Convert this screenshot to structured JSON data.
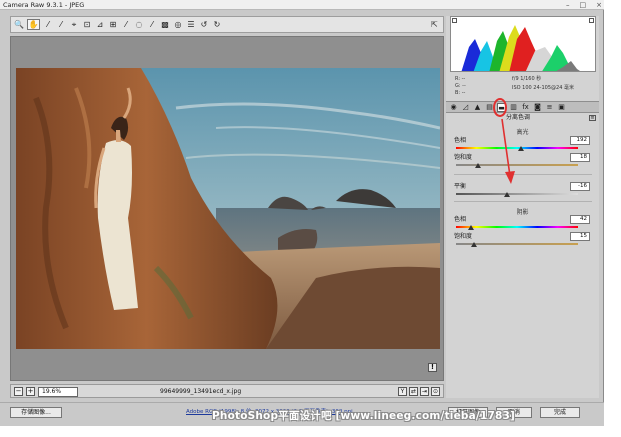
{
  "window": {
    "title": "Camera Raw 9.3.1 - JPEG",
    "controls": [
      "–",
      "□",
      "×"
    ]
  },
  "toolbar": {
    "tools": [
      {
        "icon": "zoom-icon",
        "glyph": "🔍"
      },
      {
        "icon": "hand-icon",
        "glyph": "✋"
      },
      {
        "icon": "white-balance-icon",
        "glyph": "⁄"
      },
      {
        "icon": "color-sampler-icon",
        "glyph": "⁄"
      },
      {
        "icon": "target-adjust-icon",
        "glyph": "⌖"
      },
      {
        "icon": "crop-icon",
        "glyph": "⊡"
      },
      {
        "icon": "straighten-icon",
        "glyph": "⊿"
      },
      {
        "icon": "transform-icon",
        "glyph": "⊞"
      },
      {
        "icon": "spot-removal-icon",
        "glyph": "⁄"
      },
      {
        "icon": "red-eye-icon",
        "glyph": "◌"
      },
      {
        "icon": "brush-icon",
        "glyph": "⁄"
      },
      {
        "icon": "graduated-filter-icon",
        "glyph": "▩"
      },
      {
        "icon": "radial-filter-icon",
        "glyph": "◎"
      },
      {
        "icon": "preferences-icon",
        "glyph": "☰"
      },
      {
        "icon": "rotate-left-icon",
        "glyph": "↺"
      },
      {
        "icon": "rotate-right-icon",
        "glyph": "↻"
      }
    ],
    "export_glyph": "⇱"
  },
  "readout": {
    "rgb": "R: -- \nG: -- \nB: --",
    "camera_line1": "f/9   1/160 秒",
    "camera_line2": "ISO 100  24-105@24 毫米"
  },
  "tabs": [
    {
      "icon": "basic-tab-icon",
      "glyph": "◉"
    },
    {
      "icon": "tone-curve-tab-icon",
      "glyph": "◿"
    },
    {
      "icon": "detail-tab-icon",
      "glyph": "▲"
    },
    {
      "icon": "hsl-tab-icon",
      "glyph": "▤"
    },
    {
      "icon": "split-toning-tab-icon",
      "glyph": "▬"
    },
    {
      "icon": "lens-tab-icon",
      "glyph": "▥"
    },
    {
      "icon": "fx-tab-icon",
      "glyph": "fx"
    },
    {
      "icon": "camera-calibration-tab-icon",
      "glyph": "◙"
    },
    {
      "icon": "presets-tab-icon",
      "glyph": "≡"
    },
    {
      "icon": "snapshots-tab-icon",
      "glyph": "▣"
    }
  ],
  "panel": {
    "title": "分离色调",
    "highlights_title": "高光",
    "shadows_title": "阴影",
    "highlights": [
      {
        "label": "色相",
        "value": "192",
        "position": 0.53,
        "track": "hue"
      },
      {
        "label": "饱和度",
        "value": "18",
        "position": 0.18,
        "track": "sat"
      }
    ],
    "balance": {
      "label": "平衡",
      "value": "-16",
      "position": 0.42,
      "track": "gray"
    },
    "shadows": [
      {
        "label": "色相",
        "value": "42",
        "position": 0.12,
        "track": "hue"
      },
      {
        "label": "饱和度",
        "value": "15",
        "position": 0.15,
        "track": "sat"
      }
    ]
  },
  "statusbar": {
    "zoom_minus": "−",
    "zoom_plus": "+",
    "zoom_level": "19.6%",
    "filename": "99649999_13491ecd_x.jpg"
  },
  "bottom": {
    "save_label": "存储图像...",
    "workflow_link": "Adobe RGB (1998); 8 位; 3072 x 3000 (9.2 百万像素); 300 ppi",
    "open_label": "打开图像",
    "cancel_label": "取消",
    "done_label": "完成"
  },
  "watermark": "PhotoShop平面设计吧  [www.lineeg.com/tieba/1783]",
  "colors": {
    "highlight_circle": "#e03030",
    "arrow": "#e03030"
  }
}
